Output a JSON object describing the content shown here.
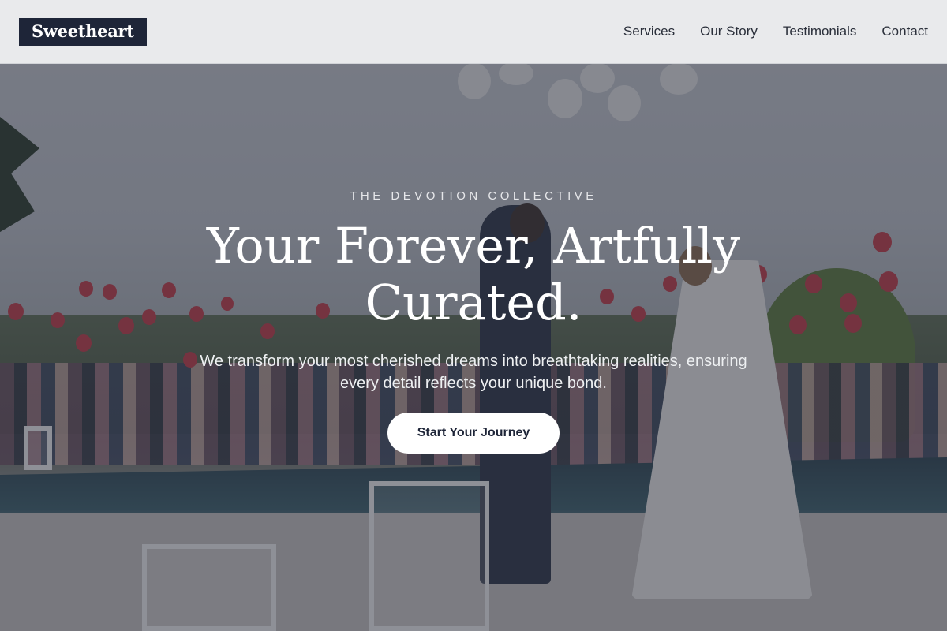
{
  "brand": {
    "logo_text": "Sweetheart"
  },
  "nav": {
    "items": [
      {
        "label": "Services"
      },
      {
        "label": "Our Story"
      },
      {
        "label": "Testimonials"
      },
      {
        "label": "Contact"
      }
    ]
  },
  "hero": {
    "eyebrow": "THE DEVOTION COLLECTIVE",
    "headline": "Your Forever, Artfully Curated.",
    "subheadline": "We transform your most cherished dreams into breathtaking realities, ensuring every detail reflects your unique bond.",
    "cta_label": "Start Your Journey"
  },
  "colors": {
    "brand_dark": "#1e2538",
    "header_bg": "#ecedef",
    "cta_bg": "#ffffff"
  }
}
